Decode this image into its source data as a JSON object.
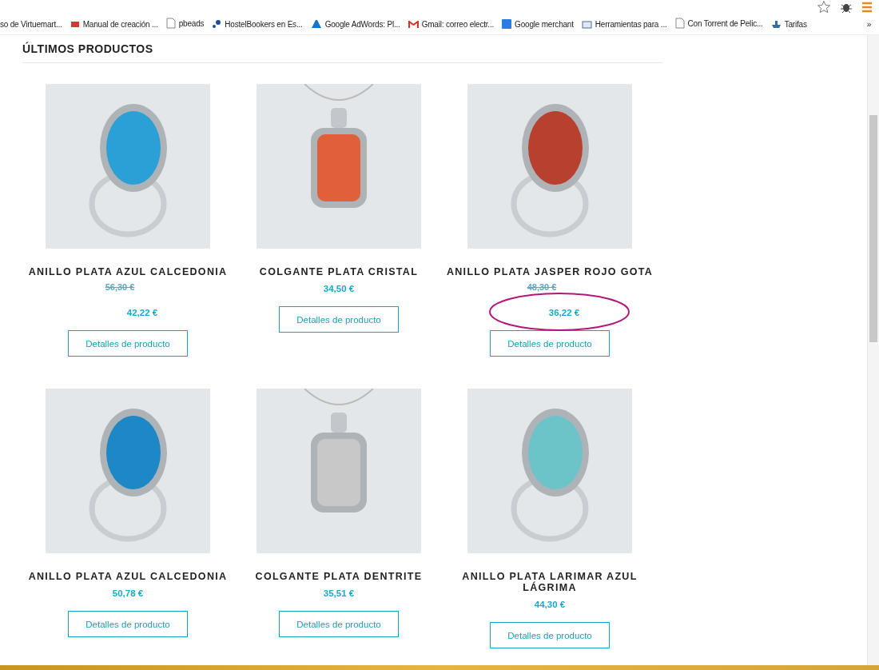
{
  "bookmarks": [
    {
      "label": "so de Virtuemart..."
    },
    {
      "label": "Manual de creación ..."
    },
    {
      "label": "pbeads"
    },
    {
      "label": "HostelBookers en Es..."
    },
    {
      "label": "Google AdWords: Pl..."
    },
    {
      "label": "Gmail: correo electr..."
    },
    {
      "label": "Google merchant"
    },
    {
      "label": "Herramientas para ..."
    },
    {
      "label": "Con Torrent de Pelic..."
    },
    {
      "label": "Tarifas"
    }
  ],
  "bookmarks_overflow": "»",
  "section": {
    "title": "ÚLTIMOS PRODUCTOS"
  },
  "products": [
    {
      "kind": "ring",
      "name": "ANILLO PLATA AZUL CALCEDONIA",
      "old_price": "56,30 €",
      "price": "42,22 €",
      "button": "Detalles de producto",
      "highlighted": false
    },
    {
      "kind": "pendant",
      "name": "COLGANTE PLATA CRISTAL",
      "price": "34,50 €",
      "button": "Detalles de producto",
      "highlighted": false
    },
    {
      "kind": "ring",
      "name": "ANILLO PLATA JASPER ROJO GOTA",
      "old_price": "48,30 €",
      "price": "36,22 €",
      "button": "Detalles de producto",
      "highlighted": true
    },
    {
      "kind": "ring",
      "name": "ANILLO PLATA AZUL CALCEDONIA",
      "price": "50,78 €",
      "button": "Detalles de producto",
      "highlighted": false
    },
    {
      "kind": "pendant",
      "name": "COLGANTE PLATA DENTRITE",
      "price": "35,51 €",
      "button": "Detalles de producto",
      "highlighted": false
    },
    {
      "kind": "ring",
      "name": "ANILLO PLATA LARIMAR AZUL LÁGRIMA",
      "price": "44,30 €",
      "button": "Detalles de producto",
      "highlighted": false
    }
  ]
}
